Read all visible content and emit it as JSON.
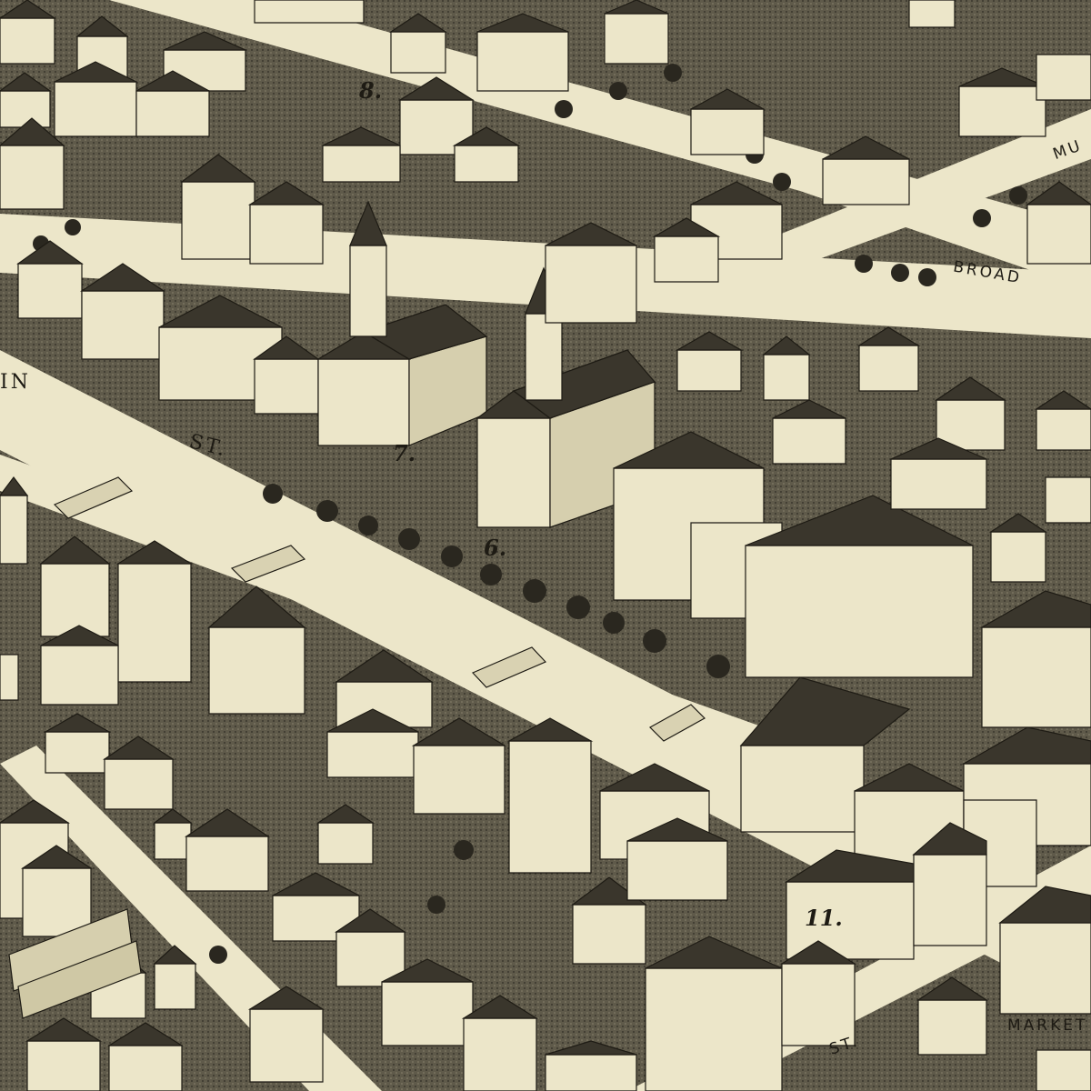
{
  "map": {
    "palette": {
      "paper": "#ece6c9",
      "ground": "#5f5a4a",
      "roof": "#3a362c",
      "ink": "#1e1b14"
    },
    "street_labels": {
      "main_fragment": "IN",
      "main_st": "ST.",
      "broad": "BROAD",
      "mu_fragment": "MU",
      "market_fragment": "MARKET",
      "lower_st": "ST."
    },
    "key_numbers": {
      "n6": "6.",
      "n7": "7.",
      "n8": "8.",
      "n11": "11."
    }
  }
}
